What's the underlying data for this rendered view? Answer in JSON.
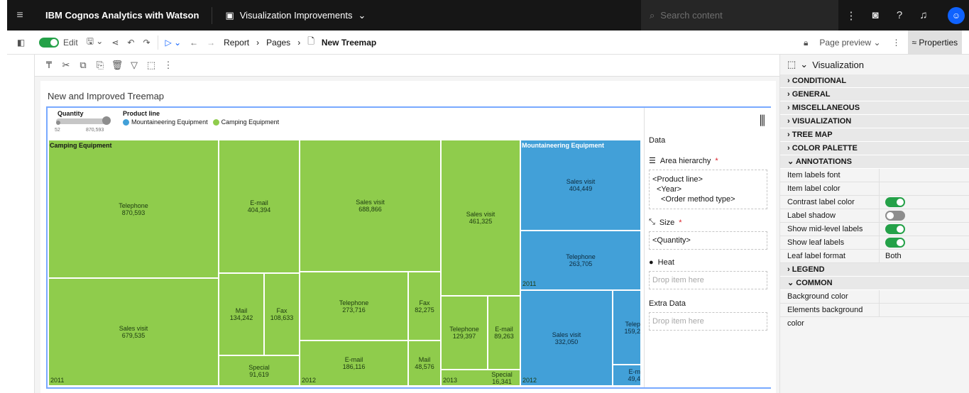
{
  "app": {
    "brand": "IBM Cognos Analytics with Watson",
    "doc_title": "Visualization Improvements",
    "search_placeholder": "Search content"
  },
  "toolbar": {
    "edit_label": "Edit",
    "breadcrumb": [
      "Report",
      "Pages",
      "New Treemap"
    ],
    "page_preview": "Page preview",
    "properties": "Properties"
  },
  "report": {
    "title": "New and Improved Treemap"
  },
  "legend": {
    "quantity_label": "Quantity",
    "quantity_min": "52",
    "quantity_max": "870,593",
    "product_line_label": "Product line",
    "items": [
      "Mountaineering Equipment",
      "Camping Equipment"
    ],
    "colors": {
      "camping": "#8fcc4c",
      "mountaineering": "#42a0d8"
    }
  },
  "treemap": {
    "groups": [
      "Camping Equipment",
      "Mountaineering Equipment"
    ],
    "camping": [
      {
        "label": "Telephone",
        "value": "870,593"
      },
      {
        "label": "Sales visit",
        "value": "679,535"
      },
      {
        "label": "E-mail",
        "value": "404,394"
      },
      {
        "label": "Mail",
        "value": "134,242"
      },
      {
        "label": "Fax",
        "value": "108,633"
      },
      {
        "label": "Special",
        "value": "91,619"
      },
      {
        "label": "Sales visit",
        "value": "688,866"
      },
      {
        "label": "Telephone",
        "value": "273,716"
      },
      {
        "label": "Fax",
        "value": "82,275"
      },
      {
        "label": "E-mail",
        "value": "186,116"
      },
      {
        "label": "Mail",
        "value": "48,576"
      },
      {
        "label": "Sales visit",
        "value": "461,325"
      },
      {
        "label": "Telephone",
        "value": "129,397"
      },
      {
        "label": "E-mail",
        "value": "89,263"
      },
      {
        "label": "Special",
        "value": "16,341"
      }
    ],
    "mountaineering": [
      {
        "label": "Sales visit",
        "value": "404,449"
      },
      {
        "label": "Telephone",
        "value": "263,705"
      },
      {
        "label": "Sales visit",
        "value": "332,050"
      },
      {
        "label": "Telep",
        "value": "159,2"
      },
      {
        "label": "E-m",
        "value": "49,4"
      }
    ],
    "years": [
      "2011",
      "2012",
      "2013",
      "2011",
      "2012"
    ]
  },
  "data_panel": {
    "title": "Data",
    "area_hierarchy": "Area hierarchy",
    "hierarchy_items": [
      "<Product line>",
      "<Year>",
      "<Order method type>"
    ],
    "size": "Size",
    "size_item": "<Quantity>",
    "heat": "Heat",
    "drop": "Drop item here",
    "extra": "Extra Data"
  },
  "properties": {
    "header": "Visualization",
    "sections_top": [
      "CONDITIONAL",
      "GENERAL",
      "MISCELLANEOUS",
      "VISUALIZATION",
      "TREE MAP",
      "COLOR PALETTE",
      "ANNOTATIONS"
    ],
    "annotations": [
      {
        "k": "Item labels font",
        "v": ""
      },
      {
        "k": "Item label color",
        "v": ""
      },
      {
        "k": "Contrast label color",
        "v": "on"
      },
      {
        "k": "Label shadow",
        "v": "off"
      },
      {
        "k": "Show mid-level labels",
        "v": "on"
      },
      {
        "k": "Show leaf labels",
        "v": "on"
      },
      {
        "k": "Leaf label format",
        "v": "Both"
      }
    ],
    "legend": "LEGEND",
    "common": "COMMON",
    "common_rows": [
      "Background color",
      "Elements background color"
    ]
  }
}
